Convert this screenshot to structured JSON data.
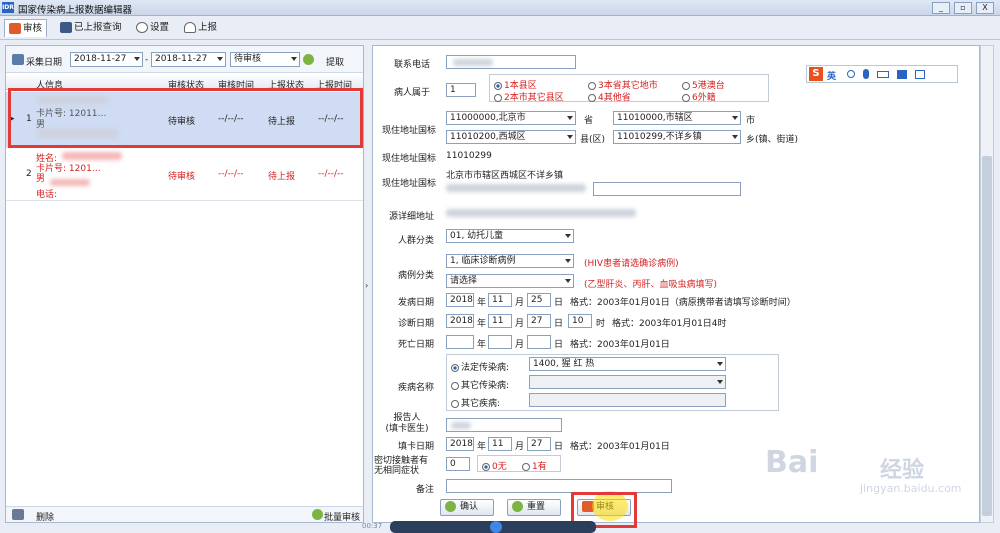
{
  "app": {
    "title": "国家传染病上报数据编辑器",
    "logo_text": "IDR"
  },
  "window_controls": [
    "_",
    "▫",
    "X"
  ],
  "toolbar": [
    {
      "label": "审核",
      "icon": "review-icon"
    },
    {
      "label": "已上报查询",
      "icon": "list-icon"
    },
    {
      "label": "设置",
      "icon": "gear-icon"
    },
    {
      "label": "上报",
      "icon": "upload-icon"
    }
  ],
  "filter": {
    "label": "采集日期",
    "start": "2018-11-27",
    "sep": "-",
    "end": "2018-11-27",
    "status": "待审核",
    "fetch_label": "提取"
  },
  "table": {
    "headers": [
      "人信息",
      "审核状态",
      "审核时间",
      "上报状态",
      "上报时间"
    ],
    "rows": [
      {
        "num": "1",
        "marker": "▸",
        "info_top": "卡片号: 12011…",
        "info_mid": "男",
        "audit": "待审核",
        "audit_time": "--/--/--",
        "report": "待上报",
        "report_time": "--/--/--"
      },
      {
        "num": "2",
        "marker": "",
        "info_top": "姓名:",
        "info_mid": "卡片号: 1201…",
        "info_bot": "男",
        "info_last": "电话:",
        "audit": "待审核",
        "audit_time": "--/--/--",
        "report": "待上报",
        "report_time": "--/--/--"
      }
    ]
  },
  "left_bottom": {
    "delete_label": "删除",
    "batch_label": "批量审核"
  },
  "form": {
    "phone_label": "联系电话",
    "belong_label": "病人属于",
    "belong_value": "1",
    "belong_options": [
      "1本县区",
      "2本市其它县区",
      "3本省其它地市",
      "4其他省",
      "5港澳台",
      "6外籍"
    ],
    "addr_label": "现住地址国标",
    "prov": "11000000,北京市",
    "prov_unit": "省",
    "city": "11010000,市辖区",
    "city_unit": "市",
    "county": "11010200,西城区",
    "county_unit": "县(区)",
    "town": "11010299,不详乡镇",
    "town_unit": "乡(镇、街道)",
    "code_label": "现住地址国标",
    "code_value": "11010299",
    "addr2_label": "现住地址国标",
    "addr2_value": "北京市市辖区西城区不详乡镇",
    "detail_label": "源详细地址",
    "crowd_label": "人群分类",
    "crowd_value": "01, 幼托儿童",
    "case_label": "病例分类",
    "case_value1": "1, 临床诊断病例",
    "case_note1": "(HIV患者请选确诊病例)",
    "case_value2": "请选择",
    "case_note2": "(乙型肝炎、丙肝、血吸虫病填写)",
    "onset": {
      "label": "发病日期",
      "y": "2018",
      "m": "11",
      "d": "25",
      "fmt": "格式：2003年01月01日（病原携带者请填写诊断时间）"
    },
    "diag": {
      "label": "诊断日期",
      "y": "2018",
      "m": "11",
      "d": "27",
      "h": "10",
      "fmt": "格式：2003年01月01日4时"
    },
    "death": {
      "label": "死亡日期",
      "fmt": "格式：2003年01月01日"
    },
    "u": {
      "y": "年",
      "m": "月",
      "d": "日",
      "h": "时"
    },
    "disease_label": "疾病名称",
    "disease_opts": [
      "法定传染病:",
      "其它传染病:",
      "其它疾病:"
    ],
    "disease_value": "1400, 猩 红 热",
    "reporter_label": "报告人\n(填卡医生)",
    "fill": {
      "label": "填卡日期",
      "y": "2018",
      "m": "11",
      "d": "27",
      "fmt": "格式：2003年01月01日"
    },
    "contact_label": "密切接触者有\n无相同症状",
    "contact_value": "0",
    "contact_opts": [
      "0无",
      "1有"
    ],
    "remark_label": "备注",
    "confirm_label": "确认",
    "reset_label": "重置",
    "audit_label": "审核"
  },
  "ime": {
    "brand": "S",
    "lang": "英"
  },
  "media": {
    "time": "00:37"
  },
  "watermark": {
    "brand": "Bai",
    "sub": "经验",
    "url": "jingyan.baidu.com"
  }
}
